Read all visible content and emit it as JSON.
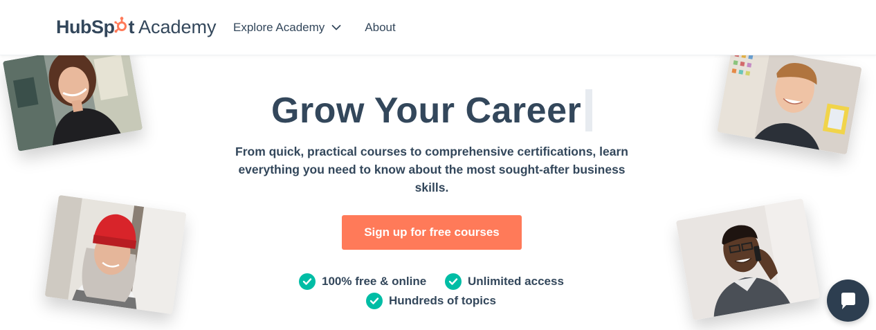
{
  "header": {
    "logo": {
      "hub": "HubSp",
      "spot": "t",
      "academy": "Academy"
    },
    "nav": [
      {
        "label": "Explore Academy",
        "has_dropdown": true
      },
      {
        "label": "About"
      }
    ]
  },
  "hero": {
    "title": "Grow Your Career",
    "subtitle": "From quick, practical courses to comprehensive certifications, learn everything you need to know about the most sought-after business skills.",
    "cta_label": "Sign up for free courses",
    "features": [
      {
        "label": "100% free & online",
        "icon": "check-circle-icon"
      },
      {
        "label": "Unlimited access",
        "icon": "check-circle-icon"
      },
      {
        "label": "Hundreds of topics",
        "icon": "check-circle-icon"
      }
    ]
  },
  "photos": [
    {
      "icon": "person-photo",
      "subject": "woman-smiling-office"
    },
    {
      "icon": "person-photo",
      "subject": "young-man-smiling"
    },
    {
      "icon": "person-photo",
      "subject": "woman-red-beanie"
    },
    {
      "icon": "person-photo",
      "subject": "man-on-phone"
    }
  ],
  "chat": {
    "icon": "chat-bubble-icon"
  },
  "colors": {
    "text": "#33475b",
    "cta": "#ff7a59",
    "check": "#00bda5",
    "chat": "#2d3e50",
    "logo_accent": "#ff7a59"
  }
}
